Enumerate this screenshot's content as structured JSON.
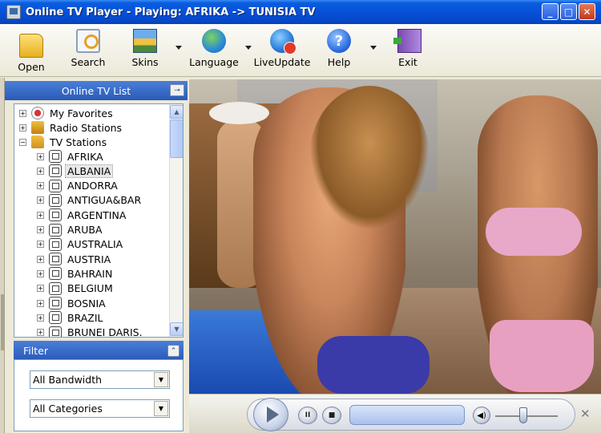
{
  "window": {
    "title": "Online TV Player - Playing: AFRIKA -> TUNISIA TV",
    "controls": {
      "minimize": "_",
      "maximize": "□",
      "close": "✕"
    }
  },
  "toolbar": {
    "items": [
      {
        "label": "Open",
        "icon": "folder-open-icon"
      },
      {
        "label": "Search",
        "icon": "search-icon"
      },
      {
        "label": "Skins",
        "icon": "skins-icon"
      },
      {
        "label": "Language",
        "icon": "globe-icon"
      },
      {
        "label": "LiveUpdate",
        "icon": "live-update-icon"
      },
      {
        "label": "Help",
        "icon": "help-icon",
        "glyph": "?"
      },
      {
        "label": "Exit",
        "icon": "exit-door-icon"
      }
    ]
  },
  "tv_list": {
    "header": "Online TV List",
    "pin_glyph": "⊸",
    "tree": {
      "expand_glyph": "+",
      "collapse_glyph": "−",
      "top_level": [
        {
          "label": "My Favorites",
          "icon": "favorites-icon",
          "expanded": false
        },
        {
          "label": "Radio Stations",
          "icon": "radio-folder-icon",
          "expanded": false
        },
        {
          "label": "TV Stations",
          "icon": "tv-folder-icon",
          "expanded": true
        }
      ],
      "stations": [
        "AFRIKA",
        "ALBANIA",
        "ANDORRA",
        "ANTIGUA&BAR",
        "ARGENTINA",
        "ARUBA",
        "AUSTRALIA",
        "AUSTRIA",
        "BAHRAIN",
        "BELGIUM",
        "BOSNIA",
        "BRAZIL",
        "BRUNEI DARIS."
      ],
      "selected": "ALBANIA"
    },
    "scroll_up": "▲",
    "scroll_down": "▼"
  },
  "filter": {
    "header": "Filter",
    "collapse_glyph": "⌃",
    "bandwidth": {
      "value": "All Bandwidth"
    },
    "categories": {
      "value": "All Categories"
    },
    "dropdown_glyph": "▼"
  },
  "player": {
    "pause_glyph": "II",
    "stop_glyph": "■",
    "volume_glyph": "◀)",
    "close_glyph": "✕"
  }
}
